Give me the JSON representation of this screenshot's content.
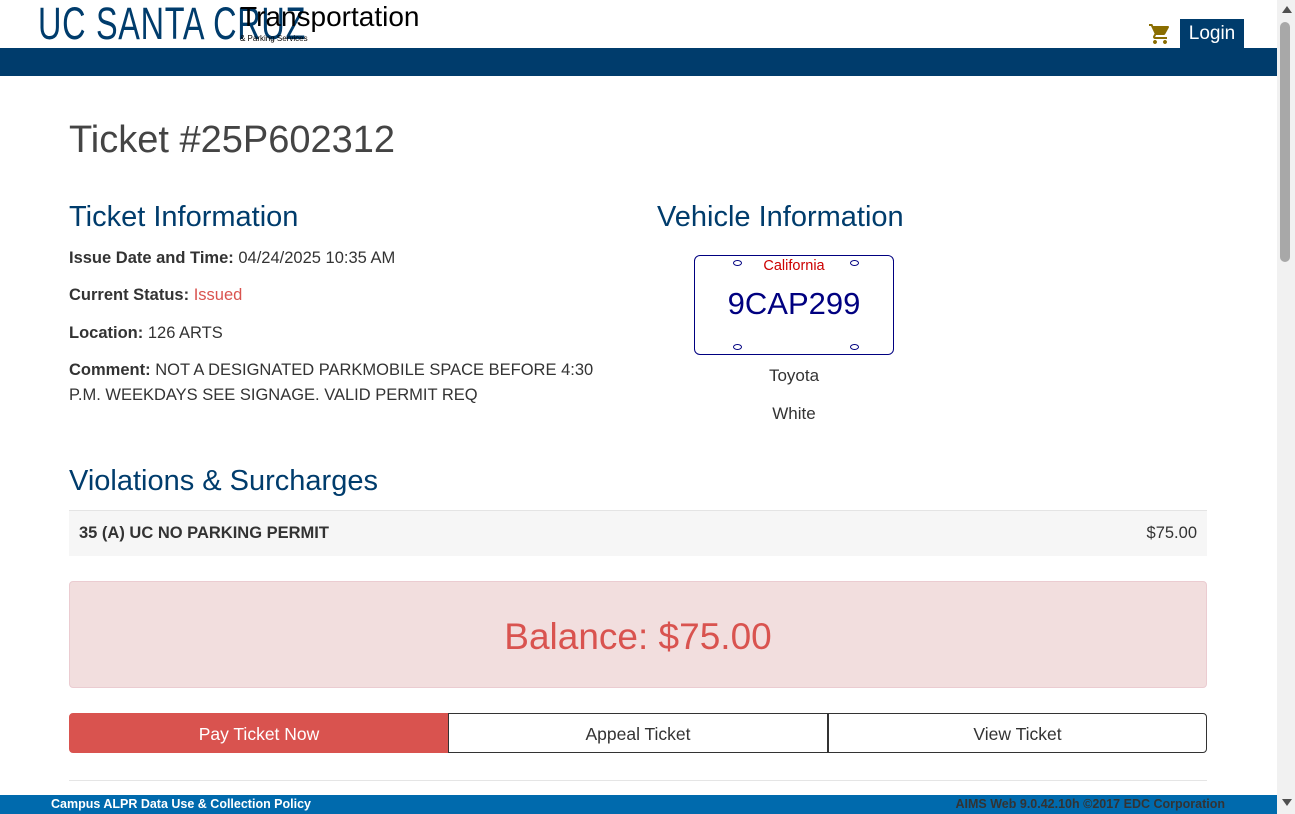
{
  "header": {
    "logo_text": "UC SANTA CRUZ",
    "logo_title": "Transportation",
    "logo_subtitle": "& Parking Services",
    "login_label": "Login",
    "cart_icon": "shopping-cart-icon"
  },
  "ticket": {
    "title": "Ticket #25P602312"
  },
  "ticket_info": {
    "heading": "Ticket Information",
    "issue_label": "Issue Date and Time:",
    "issue_value": "04/24/2025 10:35 AM",
    "status_label": "Current Status:",
    "status_value": "Issued",
    "location_label": "Location:",
    "location_value": "126 ARTS",
    "comment_label": "Comment:",
    "comment_value": "NOT A DESIGNATED PARKMOBILE SPACE BEFORE 4:30 P.M. WEEKDAYS SEE SIGNAGE. VALID PERMIT REQ"
  },
  "vehicle_info": {
    "heading": "Vehicle Information",
    "plate_state": "California",
    "plate_number": "9CAP299",
    "make": "Toyota",
    "color": "White"
  },
  "violations": {
    "heading": "Violations & Surcharges",
    "items": [
      {
        "name": "35 (A) UC NO PARKING PERMIT",
        "amount": "$75.00"
      }
    ]
  },
  "balance": {
    "text": "Balance: $75.00"
  },
  "actions": {
    "pay": "Pay Ticket Now",
    "appeal": "Appeal Ticket",
    "view": "View Ticket"
  },
  "footer": {
    "policy_link": "Campus ALPR Data Use & Collection Policy",
    "version": "AIMS Web 9.0.42.10h ©2017 EDC Corporation"
  },
  "colors": {
    "brand_navy": "#003c6c",
    "danger": "#d9534f",
    "footer_blue": "#006aad",
    "balance_bg": "#f2dede"
  }
}
